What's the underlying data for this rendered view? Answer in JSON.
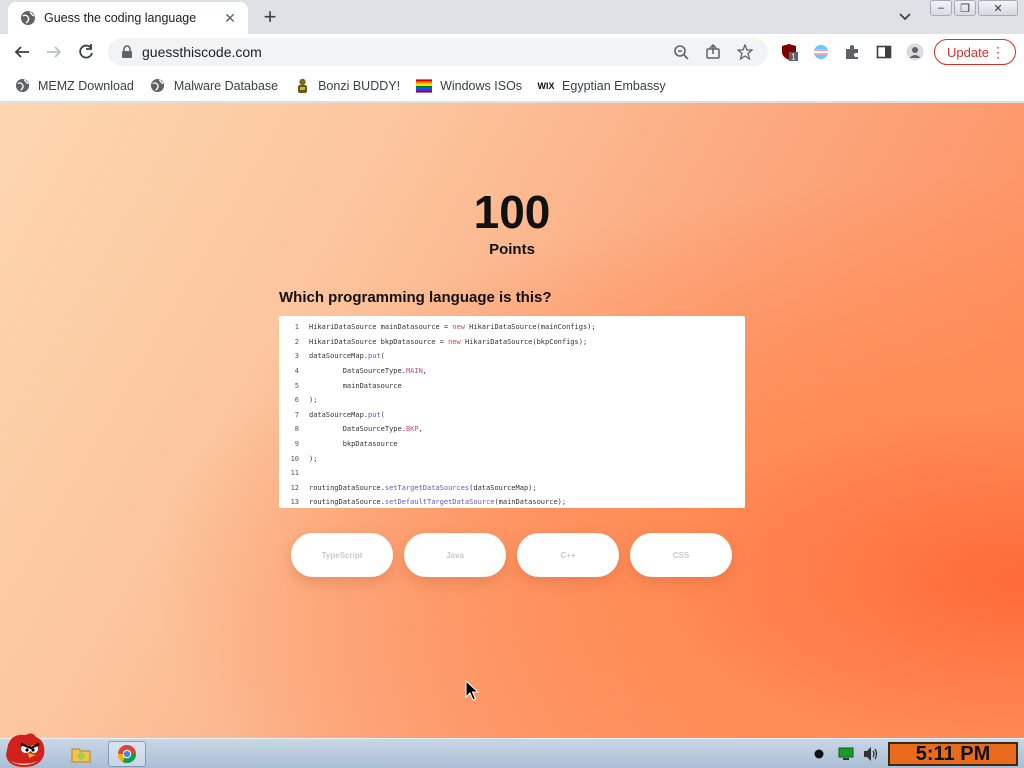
{
  "browser": {
    "tab_title": "Guess the coding language",
    "url": "guessthiscode.com",
    "update_label": "Update",
    "extension_badge": "1"
  },
  "bookmarks": [
    {
      "label": "MEMZ Download",
      "icon": "globe-icon"
    },
    {
      "label": "Malware Database",
      "icon": "globe-icon"
    },
    {
      "label": "Bonzi BUDDY!",
      "icon": "bonzi-icon"
    },
    {
      "label": "Windows ISOs",
      "icon": "rainbow-flag-icon"
    },
    {
      "label": "Egyptian Embassy",
      "icon": "wix-icon"
    }
  ],
  "game": {
    "score": "100",
    "points_label": "Points",
    "question": "Which programming language is this?",
    "code_lines": [
      {
        "n": "1",
        "text": "HikariDataSource mainDatasource = new HikariDataSource(mainConfigs);"
      },
      {
        "n": "2",
        "text": "HikariDataSource bkpDatasource = new HikariDataSource(bkpConfigs);"
      },
      {
        "n": "3",
        "text": "dataSourceMap.put("
      },
      {
        "n": "4",
        "text": "        DataSourceType.MAIN,"
      },
      {
        "n": "5",
        "text": "        mainDatasource"
      },
      {
        "n": "6",
        "text": ");"
      },
      {
        "n": "7",
        "text": "dataSourceMap.put("
      },
      {
        "n": "8",
        "text": "        DataSourceType.BKP,"
      },
      {
        "n": "9",
        "text": "        bkpDatasource"
      },
      {
        "n": "10",
        "text": ");"
      },
      {
        "n": "11",
        "text": ""
      },
      {
        "n": "12",
        "text": "routingDataSource.setTargetDataSources(dataSourceMap);"
      },
      {
        "n": "13",
        "text": "routingDataSource.setDefaultTargetDataSource(mainDatasource);"
      }
    ],
    "answers": [
      "TypeScript",
      "Java",
      "C++",
      "CSS"
    ]
  },
  "taskbar": {
    "clock": "5:11 PM"
  },
  "colors": {
    "update_red": "#d93025",
    "clock_bg": "#e86a1c",
    "background_orange": "#ff8350"
  }
}
